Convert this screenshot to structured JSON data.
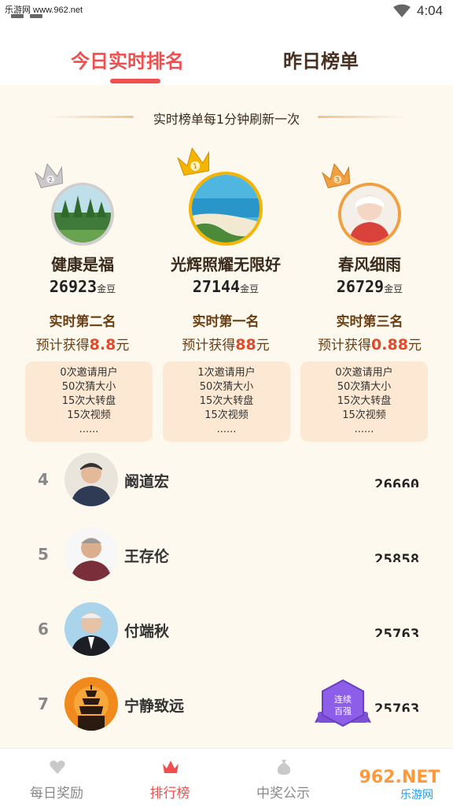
{
  "status_bar": {
    "watermark": "乐游网 www.962.net",
    "time": "4:04"
  },
  "tabs": {
    "today": "今日实时排名",
    "yesterday": "昨日榜单"
  },
  "refresh_note": "实时榜单每1分钟刷新一次",
  "podium": [
    {
      "crown_number": "2",
      "name": "健康是福",
      "score": "26923",
      "unit": "金豆",
      "rank_label": "实时第二名",
      "reward_prefix": "预计获得",
      "reward_amount": "8.8",
      "reward_unit": "元",
      "tasks": [
        "0次邀请用户",
        "50次猜大小",
        "15次大转盘",
        "15次视频",
        "......"
      ]
    },
    {
      "crown_number": "1",
      "name": "光辉照耀无限好",
      "score": "27144",
      "unit": "金豆",
      "rank_label": "实时第一名",
      "reward_prefix": "预计获得",
      "reward_amount": "88",
      "reward_unit": "元",
      "tasks": [
        "1次邀请用户",
        "50次猜大小",
        "15次大转盘",
        "15次视频",
        "......"
      ]
    },
    {
      "crown_number": "3",
      "name": "春风细雨",
      "score": "26729",
      "unit": "金豆",
      "rank_label": "实时第三名",
      "reward_prefix": "预计获得",
      "reward_amount": "0.88",
      "reward_unit": "元",
      "tasks": [
        "0次邀请用户",
        "50次猜大小",
        "15次大转盘",
        "15次视频",
        "......"
      ]
    }
  ],
  "list": [
    {
      "rank": "4",
      "name": "阚道宏",
      "score": "26660"
    },
    {
      "rank": "5",
      "name": "王存伦",
      "score": "25858"
    },
    {
      "rank": "6",
      "name": "付端秋",
      "score": "25763"
    },
    {
      "rank": "7",
      "name": "宁静致远",
      "score": "25763",
      "badge_line1": "连续",
      "badge_line2": "百强"
    }
  ],
  "bottom_nav": [
    {
      "label": "每日奖励",
      "icon": "heart-gift-icon"
    },
    {
      "label": "排行榜",
      "icon": "crown-icon"
    },
    {
      "label": "中奖公示",
      "icon": "money-bag-icon"
    }
  ],
  "corner_logo": {
    "text_top": "962.NET",
    "text_bottom": "乐游网"
  },
  "colors": {
    "accent": "#ef4f4f",
    "panel_bg": "#fdf9ef",
    "task_bg": "#fde9d3",
    "gold": "#f5b400",
    "brown": "#6b3e12"
  }
}
